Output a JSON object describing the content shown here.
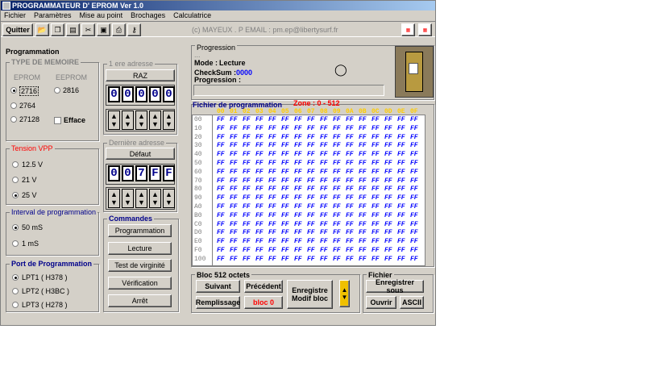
{
  "window": {
    "title": "PROGRAMMATEUR D' EPROM Ver 1.0"
  },
  "menu": [
    "Fichier",
    "Paramètres",
    "Mise au point",
    "Brochages",
    "Calculatrice"
  ],
  "toolbar": {
    "quit_label": "Quitter",
    "author": "(c) MAYEUX . P    EMAIL :   pm.ep@libertysurf.fr"
  },
  "programmation": {
    "title": "Programmation",
    "memtype": {
      "title": "TYPE DE MEMOIRE",
      "eprom_hdr": "EPROM",
      "eeprom_hdr": "EEPROM",
      "opt_2716": "2716",
      "opt_2764": "2764",
      "opt_27128": "27128",
      "opt_2816": "2816",
      "efface": "Efface"
    },
    "vpp": {
      "title": "Tension VPP",
      "v125": "12.5 V",
      "v21": "21 V",
      "v25": "25 V"
    },
    "interval": {
      "title": "Interval de programmation",
      "ms50": "50 mS",
      "ms1": "1 mS"
    },
    "port": {
      "title": "Port de Programmation",
      "lpt1": "LPT1 ( H378 )",
      "lpt2": "LPT2 ( H3BC )",
      "lpt3": "LPT3 ( H278 )"
    }
  },
  "address": {
    "first_title": "1 ere adresse",
    "raz": "RAZ",
    "first_digits": [
      "0",
      "0",
      "0",
      "0",
      "0"
    ],
    "last_title": "Dernière adresse",
    "defaut": "Défaut",
    "last_digits": [
      "0",
      "0",
      "7",
      "F",
      "F"
    ]
  },
  "commands": {
    "title": "Commandes",
    "programmation": "Programmation",
    "lecture": "Lecture",
    "virginite": "Test de virginité",
    "verification": "Vérification",
    "arret": "Arrêt"
  },
  "progress": {
    "title": "Progression",
    "dots": "...",
    "mode_label": "Mode :",
    "mode_value": "Lecture",
    "checksum_label": "CheckSum :",
    "checksum_value": "0000",
    "progress_label": "Progression :",
    "fill": 0
  },
  "hex": {
    "title": "Fichier de programmation",
    "zone": "Zone : 0 - 512",
    "columns": [
      "00",
      "01",
      "02",
      "03",
      "04",
      "05",
      "06",
      "07",
      "08",
      "09",
      "0A",
      "0B",
      "0C",
      "0D",
      "0E",
      "0F"
    ],
    "rows": [
      "00",
      "10",
      "20",
      "30",
      "40",
      "50",
      "60",
      "70",
      "80",
      "90",
      "A0",
      "B0",
      "C0",
      "D0",
      "E0",
      "F0",
      "100"
    ],
    "cell_value": "FF"
  },
  "bloc": {
    "title": "Bloc 512 octets",
    "suivant": "Suivant",
    "precedent": "Précédent",
    "remplissage": "Remplissage",
    "bloc_value": "bloc 0",
    "enregistre": "Enregistre\nModif  bloc"
  },
  "fichier": {
    "title": "Fichier",
    "enregistrer": "Enregistrer sous",
    "ouvrir": "Ouvrir",
    "ascii": "ASCII"
  },
  "colors": {
    "accent_red": "#ff0000",
    "digit_blue": "#00008b",
    "hex_blue": "#0000ff",
    "header_yellow": "#ffcc00"
  }
}
